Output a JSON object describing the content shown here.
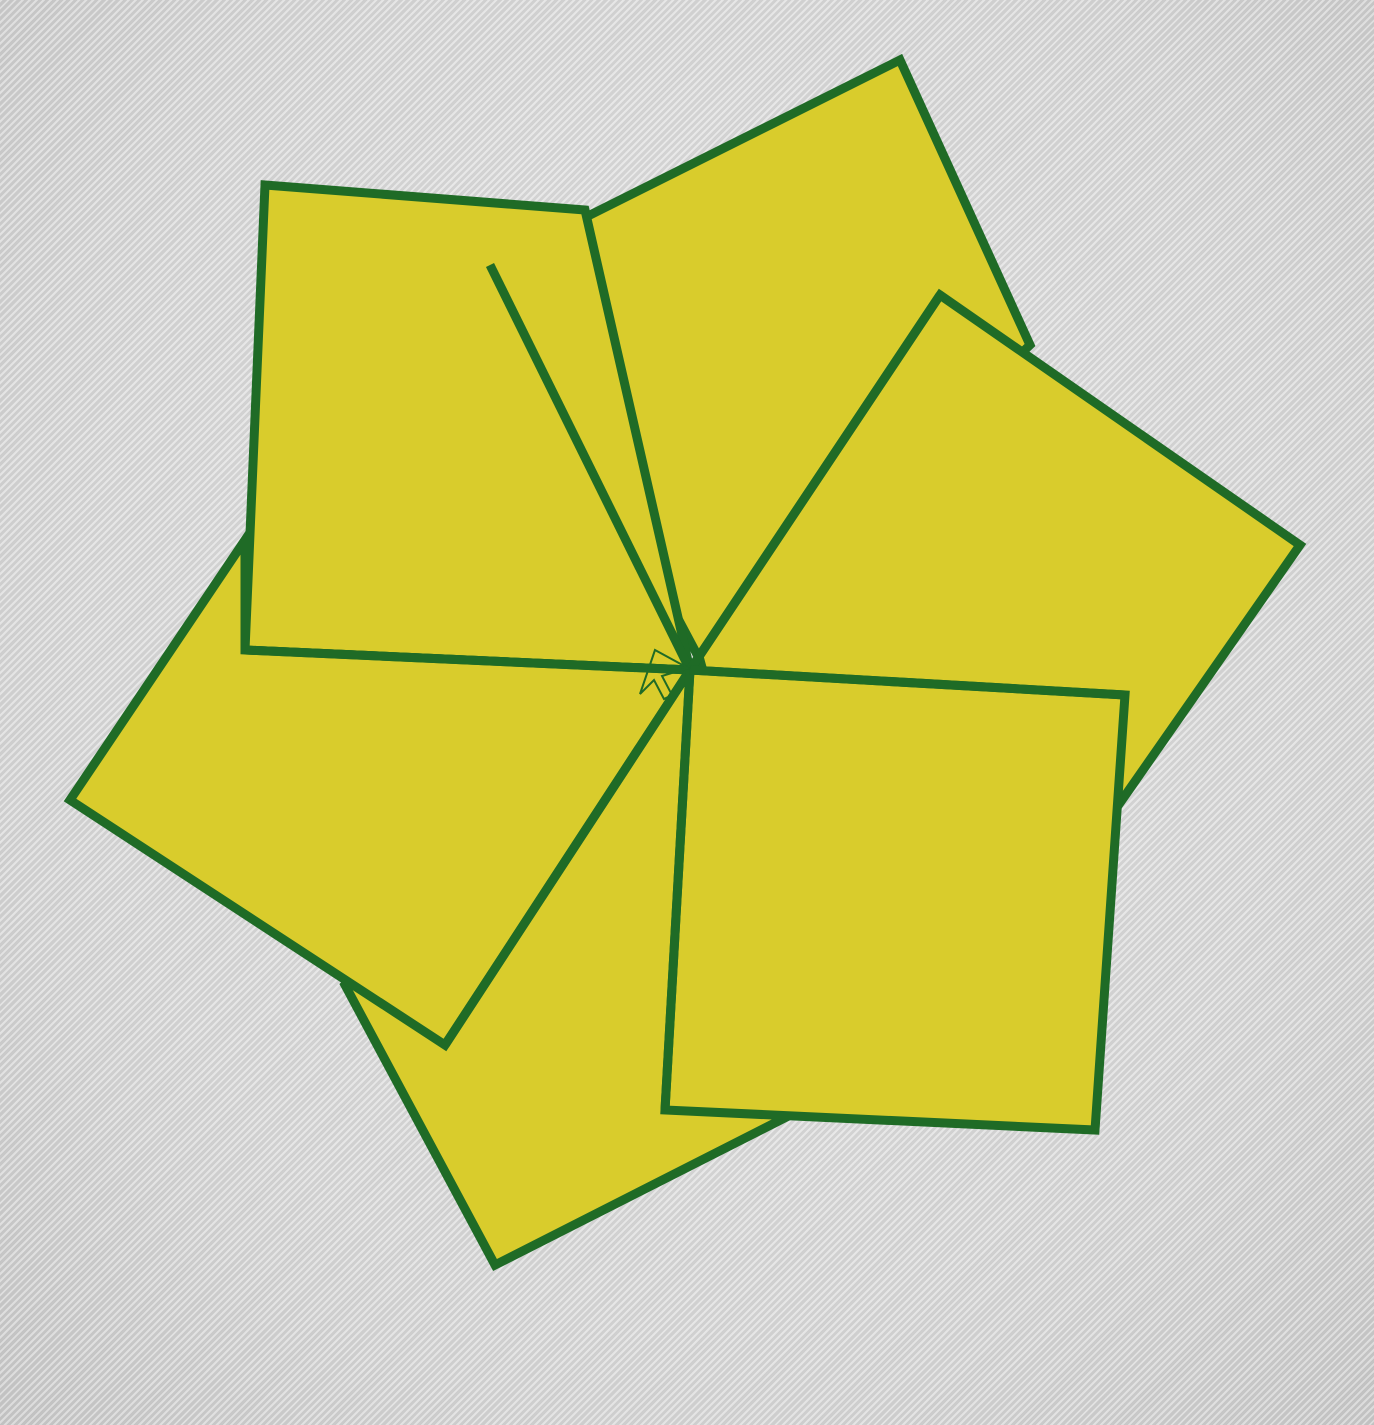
{
  "figure": {
    "type": "rotated-squares-pinwheel",
    "square_count": 6,
    "rotation_step_degrees": 60,
    "shared_corner": "center",
    "fill_color": "#d9cc2c",
    "stroke_color": "#1f6b26",
    "background_color": "#dcdcdc",
    "cursor_icon": "mouse-pointer-icon"
  }
}
